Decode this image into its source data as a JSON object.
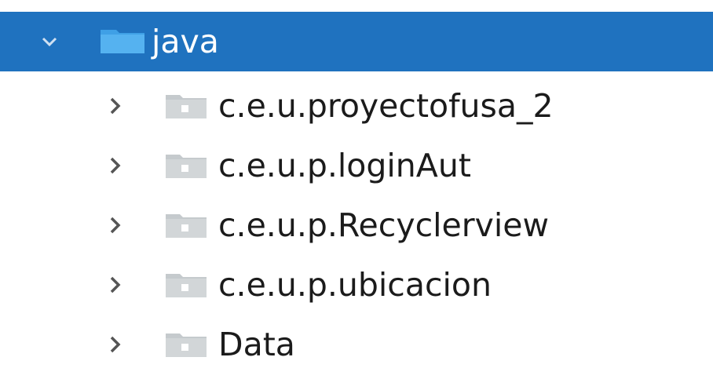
{
  "tree": {
    "root": {
      "label": "java",
      "expanded": true,
      "selected": true,
      "icon": "folder-icon",
      "color": "#1f72bf"
    },
    "children": [
      {
        "label": "c.e.u.proyectofusa_2",
        "icon": "package-icon",
        "expanded": false
      },
      {
        "label": "c.e.u.p.loginAut",
        "icon": "package-icon",
        "expanded": false
      },
      {
        "label": "c.e.u.p.Recyclerview",
        "icon": "package-icon",
        "expanded": false
      },
      {
        "label": "c.e.u.p.ubicacion",
        "icon": "package-icon",
        "expanded": false
      },
      {
        "label": "Data",
        "icon": "package-icon",
        "expanded": false
      }
    ]
  }
}
